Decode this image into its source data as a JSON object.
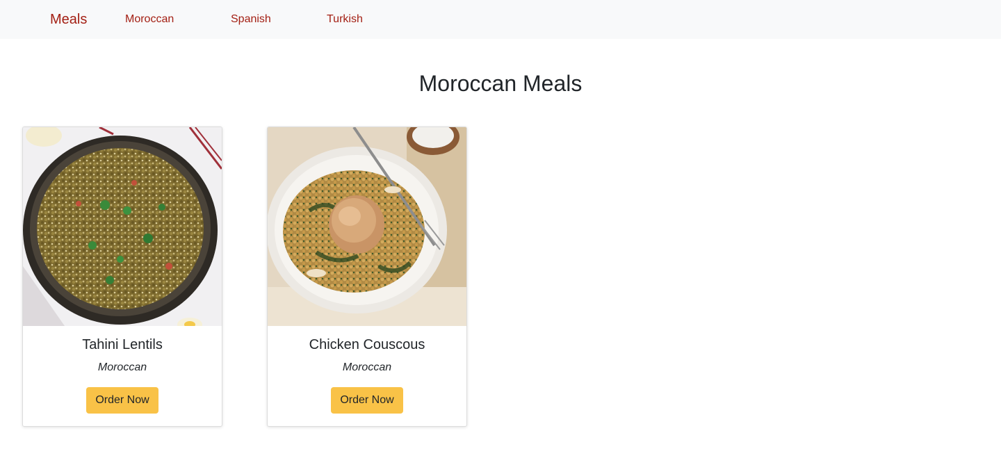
{
  "navbar": {
    "brand": "Meals",
    "items": [
      {
        "label": "Moroccan"
      },
      {
        "label": "Spanish"
      },
      {
        "label": "Turkish"
      }
    ]
  },
  "page": {
    "title": "Moroccan Meals"
  },
  "meals": [
    {
      "name": "Tahini Lentils",
      "category": "Moroccan",
      "button_label": "Order Now",
      "image_subject": "lentil-dish-photo"
    },
    {
      "name": "Chicken Couscous",
      "category": "Moroccan",
      "button_label": "Order Now",
      "image_subject": "chicken-couscous-photo"
    }
  ],
  "colors": {
    "nav_background": "#f8f9fa",
    "link": "#a31f13",
    "button": "#f9c247",
    "text": "#212529"
  }
}
